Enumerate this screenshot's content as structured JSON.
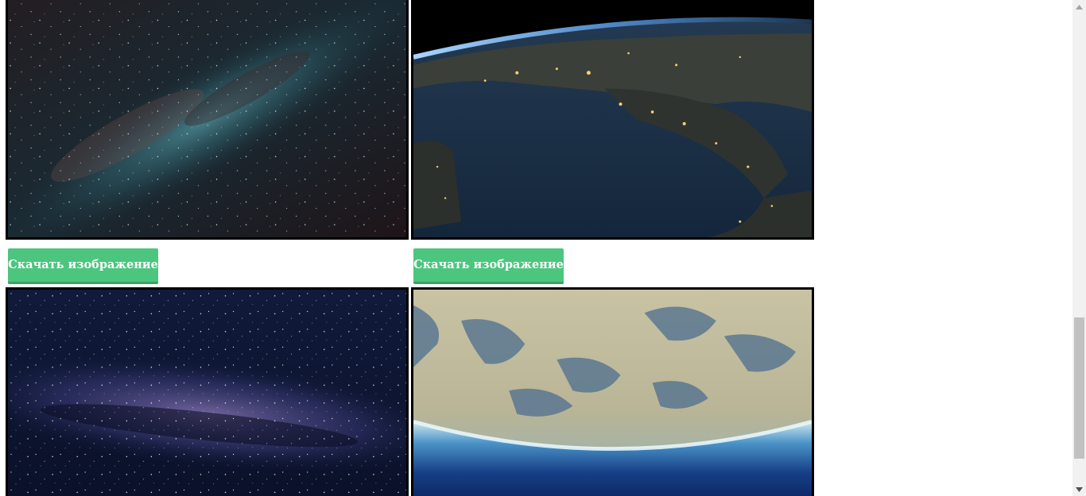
{
  "gallery": {
    "images": [
      {
        "name": "milky-way-teal",
        "alt": ""
      },
      {
        "name": "earth-night-italy",
        "alt": ""
      },
      {
        "name": "milky-way-purple",
        "alt": ""
      },
      {
        "name": "earth-horizon-desert",
        "alt": ""
      }
    ],
    "download_buttons": [
      {
        "label": "Скачать изображение"
      },
      {
        "label": "Скачать изображение"
      }
    ]
  },
  "colors": {
    "button_bg": "#4cc57f",
    "button_shadow": "#3aa366",
    "tile_border": "#000000",
    "scrollbar_track": "#f1f1f1",
    "scrollbar_thumb": "#c1c1c1"
  },
  "icons": {
    "scroll_up": "scroll-up-arrow-icon",
    "scroll_down": "scroll-down-arrow-icon"
  }
}
